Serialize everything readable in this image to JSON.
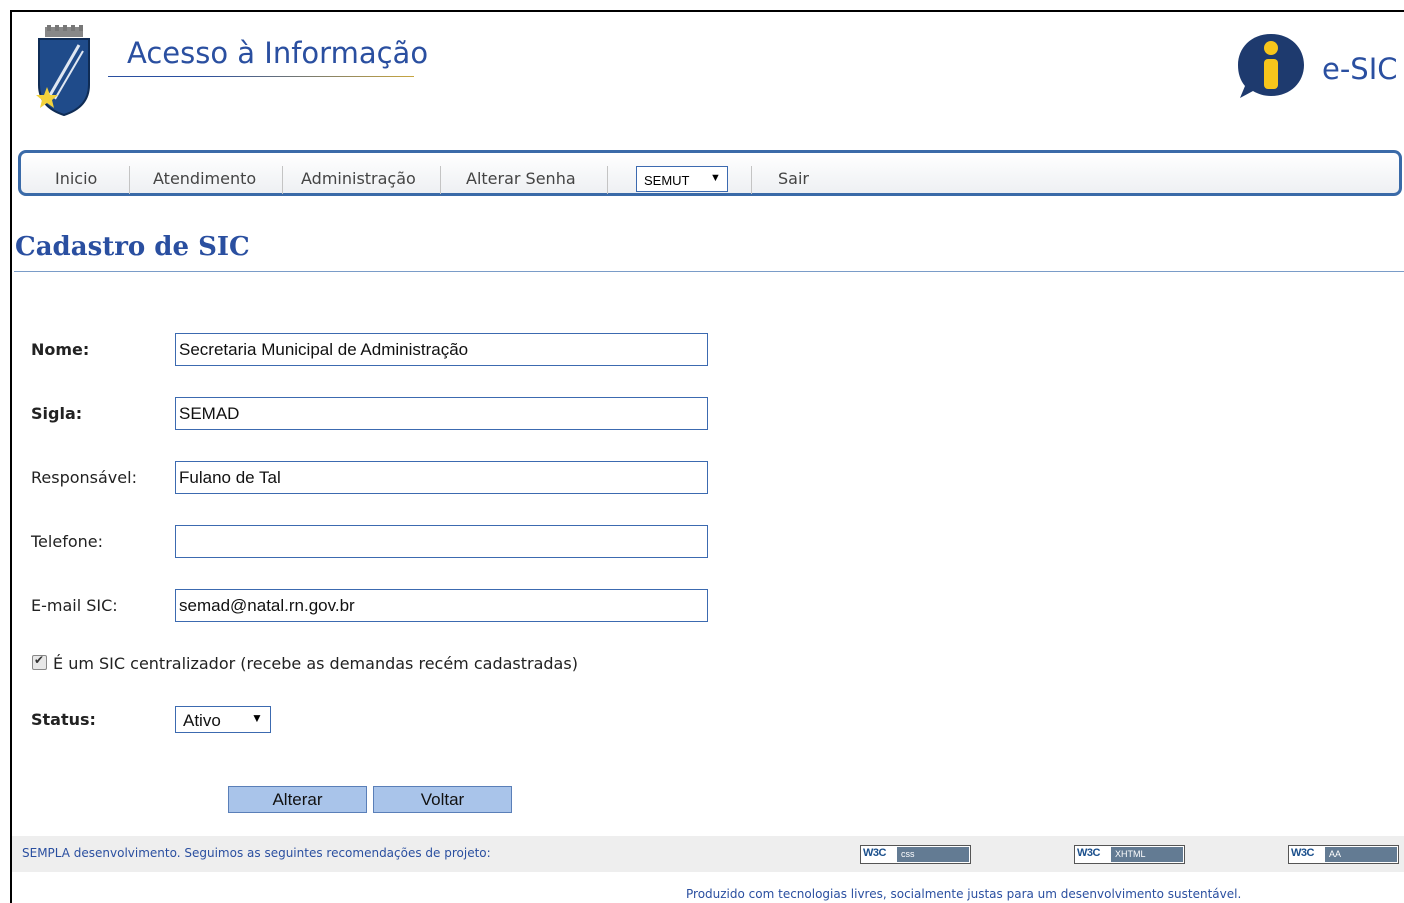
{
  "header": {
    "site_title": "Acesso à Informação",
    "esic_label": "e-SIC",
    "logo_icon": "city-coat-of-arms-icon",
    "esic_icon": "info-speech-bubble-icon"
  },
  "nav": {
    "items": [
      "Inicio",
      "Atendimento",
      "Administração",
      "Alterar Senha"
    ],
    "unit_select": "SEMUT",
    "logout": "Sair"
  },
  "page": {
    "title": "Cadastro de SIC"
  },
  "form": {
    "nome_label": "Nome:",
    "nome_value": "Secretaria Municipal de Administração",
    "sigla_label": "Sigla:",
    "sigla_value": "SEMAD",
    "responsavel_label": "Responsável:",
    "responsavel_value": "Fulano de Tal",
    "telefone_label": "Telefone:",
    "telefone_value": "",
    "email_label": "E-mail SIC:",
    "email_value": "semad@natal.rn.gov.br",
    "centralizador_label": "É um SIC centralizador (recebe as demandas recém cadastradas)",
    "centralizador_checked": true,
    "status_label": "Status:",
    "status_value": "Ativo",
    "alterar_button": "Alterar",
    "voltar_button": "Voltar"
  },
  "footer": {
    "text": "SEMPLA desenvolvimento. Seguimos as seguintes recomendações de projeto:",
    "badges": [
      {
        "w3c": "W3C",
        "tag": "css"
      },
      {
        "w3c": "W3C",
        "tag": "XHTML"
      },
      {
        "w3c": "W3C",
        "tag": "AA"
      }
    ],
    "produced": "Produzido com tecnologias livres, socialmente justas para um desenvolvimento sustentável."
  },
  "colors": {
    "accent": "#2a4fa0",
    "nav_border": "#3a6aa8",
    "button_bg": "#a9c4ea",
    "footer_bg": "#eeeeee"
  }
}
